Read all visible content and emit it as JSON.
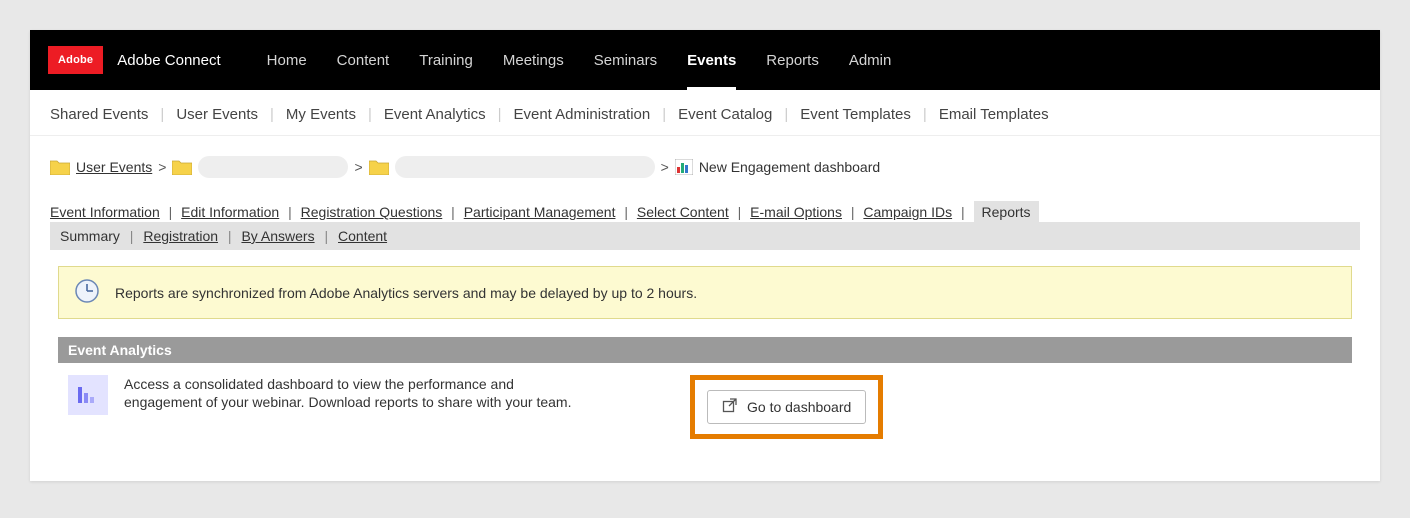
{
  "header": {
    "logo_text": "Adobe",
    "product_name": "Adobe Connect",
    "nav": [
      "Home",
      "Content",
      "Training",
      "Meetings",
      "Seminars",
      "Events",
      "Reports",
      "Admin"
    ],
    "active_nav_index": 5
  },
  "subnav": [
    "Shared Events",
    "User Events",
    "My Events",
    "Event Analytics",
    "Event Administration",
    "Event Catalog",
    "Event Templates",
    "Email Templates"
  ],
  "breadcrumb": {
    "first": "User Events",
    "final": "New Engagement dashboard"
  },
  "detail_tabs": {
    "items": [
      "Event Information",
      "Edit Information",
      "Registration Questions",
      "Participant Management",
      "Select Content",
      "E-mail Options",
      "Campaign IDs"
    ],
    "current": "Reports"
  },
  "report_subtabs": [
    "Summary",
    "Registration",
    "By Answers",
    "Content"
  ],
  "alert_text": "Reports are synchronized from Adobe Analytics servers and may be delayed by up to 2 hours.",
  "analytics": {
    "section_title": "Event Analytics",
    "description": "Access a consolidated dashboard to view the performance and engagement of your webinar. Download reports to share with your team.",
    "button_label": "Go to dashboard"
  }
}
